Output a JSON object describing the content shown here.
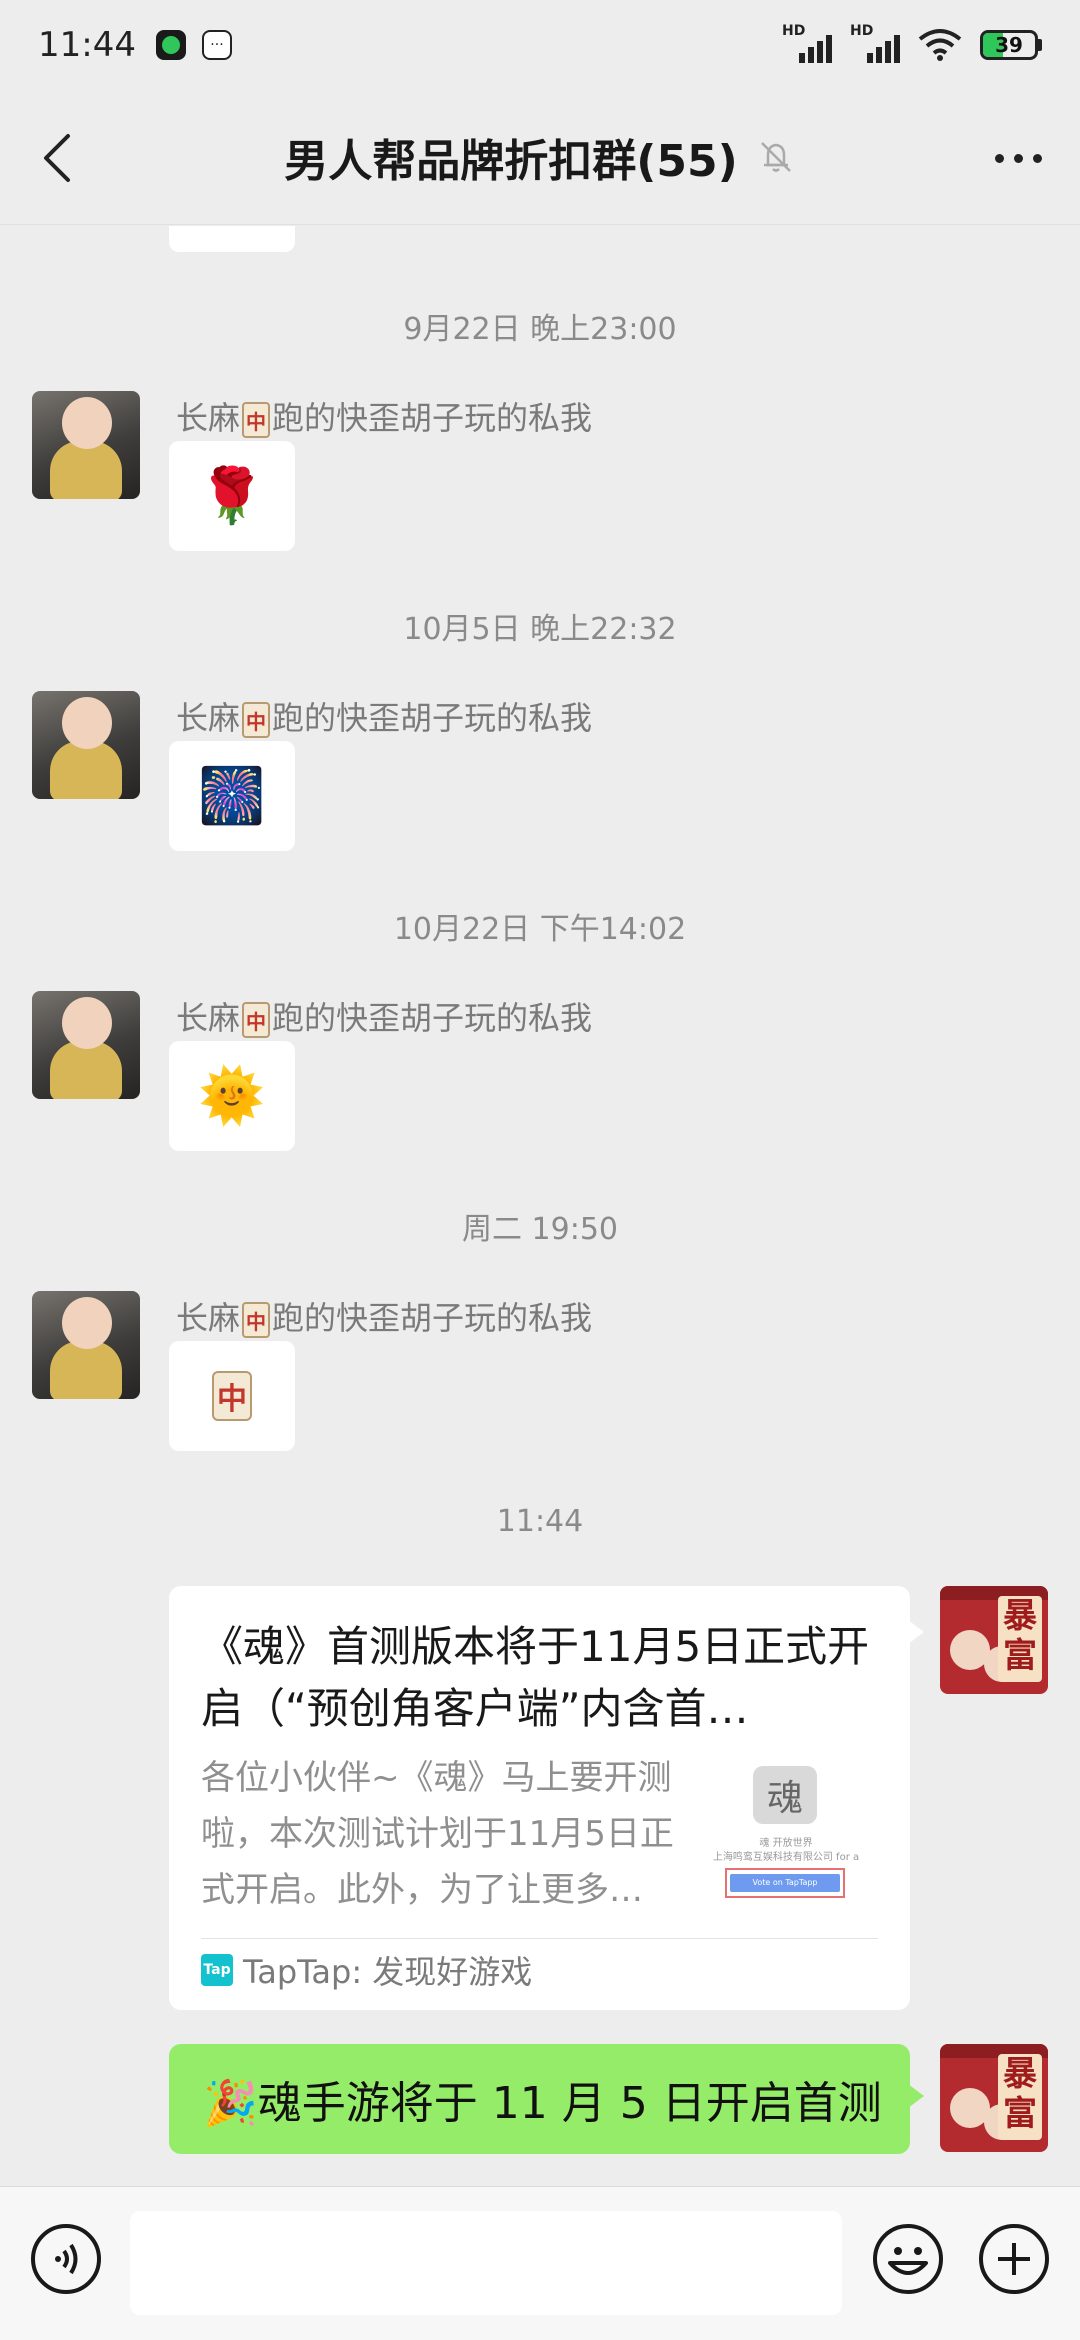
{
  "status_bar": {
    "time": "11:44",
    "battery": "39",
    "battery_level": 0.39,
    "signal_1_label": "HD",
    "signal_2_label": "HD"
  },
  "nav": {
    "title": "男人帮品牌折扣群(55)"
  },
  "messages": [
    {
      "time": "9月22日 晚上23:00",
      "sender": "长麻",
      "sender_suffix": "跑的快歪胡子玩的私我",
      "emoji": "🌹"
    },
    {
      "time": "10月5日 晚上22:32",
      "sender": "长麻",
      "sender_suffix": "跑的快歪胡子玩的私我",
      "emoji": "🎆"
    },
    {
      "time": "10月22日 下午14:02",
      "sender": "长麻",
      "sender_suffix": "跑的快歪胡子玩的私我",
      "emoji": "🌞"
    },
    {
      "time": "周二 19:50",
      "sender": "长麻",
      "sender_suffix": "跑的快歪胡子玩的私我",
      "emoji": "中"
    }
  ],
  "mahjong_char": "中",
  "last_time": "11:44",
  "link_card": {
    "title": "《魂》首测版本将于11月5日正式开启（“预创角客户端”内含首…",
    "description": "各位小伙伴~《魂》马上要开测啦，本次测试计划于11月5日正式开启。此外，为了让更多…",
    "thumb_logo": "魂",
    "thumb_line1": "魂 开放世界",
    "thumb_line2": "上海鸣鸾互娱科技有限公司 for a",
    "thumb_button": "Vote on TapTapp",
    "source_icon": "Tap",
    "source": "TapTap: 发现好游戏"
  },
  "green_message": "🎉魂手游将于 11 月 5 日开启首测",
  "avatar_right_char": "暴富",
  "icons": {
    "back": "chevron-left-icon",
    "mute": "bell-off-icon",
    "more": "more-dots-icon",
    "voice": "voice-icon",
    "emoji": "emoji-icon",
    "plus": "plus-icon"
  }
}
